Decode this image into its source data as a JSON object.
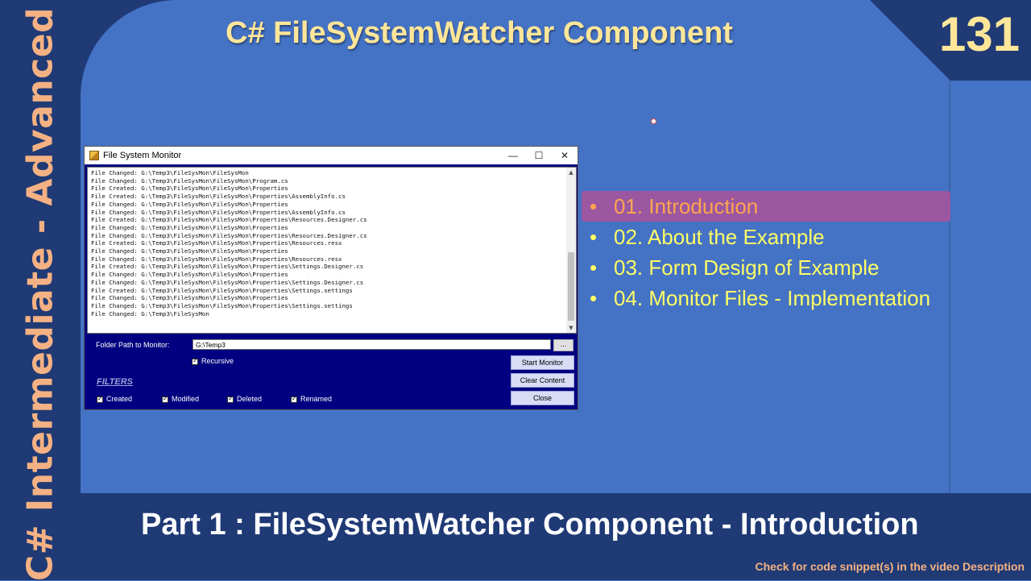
{
  "slide": {
    "title": "C# FileSystemWatcher Component",
    "episode_number": "131",
    "side_label": "C# Intermediate - Advanced",
    "subtitle": "Part 1 : FileSystemWatcher Component - Introduction",
    "footnote": "Check for code snippet(s) in the video Description",
    "colors": {
      "background": "#4472c4",
      "band": "#1f3a75",
      "title": "#ffe699",
      "side": "#f4b183",
      "agenda": "#ffff66",
      "agenda_active_bg": "#9b57a0"
    }
  },
  "window": {
    "title": "File System Monitor",
    "controls": {
      "minimize": "—",
      "maximize": "☐",
      "close": "✕"
    },
    "log_lines": [
      "File Changed: G:\\Temp3\\FileSysMon\\FileSysMon",
      "File Changed: G:\\Temp3\\FileSysMon\\FileSysMon\\Program.cs",
      "File Created: G:\\Temp3\\FileSysMon\\FileSysMon\\Properties",
      "File Created: G:\\Temp3\\FileSysMon\\FileSysMon\\Properties\\AssemblyInfo.cs",
      "File Changed: G:\\Temp3\\FileSysMon\\FileSysMon\\Properties",
      "File Changed: G:\\Temp3\\FileSysMon\\FileSysMon\\Properties\\AssemblyInfo.cs",
      "File Created: G:\\Temp3\\FileSysMon\\FileSysMon\\Properties\\Resources.Designer.cs",
      "File Changed: G:\\Temp3\\FileSysMon\\FileSysMon\\Properties",
      "File Changed: G:\\Temp3\\FileSysMon\\FileSysMon\\Properties\\Resources.Designer.cs",
      "File Created: G:\\Temp3\\FileSysMon\\FileSysMon\\Properties\\Resources.resx",
      "File Changed: G:\\Temp3\\FileSysMon\\FileSysMon\\Properties",
      "File Changed: G:\\Temp3\\FileSysMon\\FileSysMon\\Properties\\Resources.resx",
      "File Created: G:\\Temp3\\FileSysMon\\FileSysMon\\Properties\\Settings.Designer.cs",
      "File Changed: G:\\Temp3\\FileSysMon\\FileSysMon\\Properties",
      "File Changed: G:\\Temp3\\FileSysMon\\FileSysMon\\Properties\\Settings.Designer.cs",
      "File Created: G:\\Temp3\\FileSysMon\\FileSysMon\\Properties\\Settings.settings",
      "File Changed: G:\\Temp3\\FileSysMon\\FileSysMon\\Properties",
      "File Changed: G:\\Temp3\\FileSysMon\\FileSysMon\\Properties\\Settings.settings",
      "File Changed: G:\\Temp3\\FileSysMon"
    ],
    "folder_label": "Folder Path to Monitor:",
    "folder_value": "G:\\Temp3",
    "browse_label": "...",
    "recursive_label": "Recursive",
    "filters_label": "FILTERS",
    "filters": [
      "Created",
      "Modified",
      "Deleted",
      "Renamed"
    ],
    "buttons": {
      "start": "Start Monitor",
      "clear": "Clear Content",
      "close": "Close"
    }
  },
  "agenda": {
    "items": [
      {
        "bullet": "•",
        "label": "01. Introduction",
        "active": true
      },
      {
        "bullet": "•",
        "label": "02. About the Example",
        "active": false
      },
      {
        "bullet": "•",
        "label": "03. Form Design of Example",
        "active": false
      },
      {
        "bullet": "•",
        "label": "04. Monitor Files - Implementation",
        "active": false
      }
    ]
  }
}
